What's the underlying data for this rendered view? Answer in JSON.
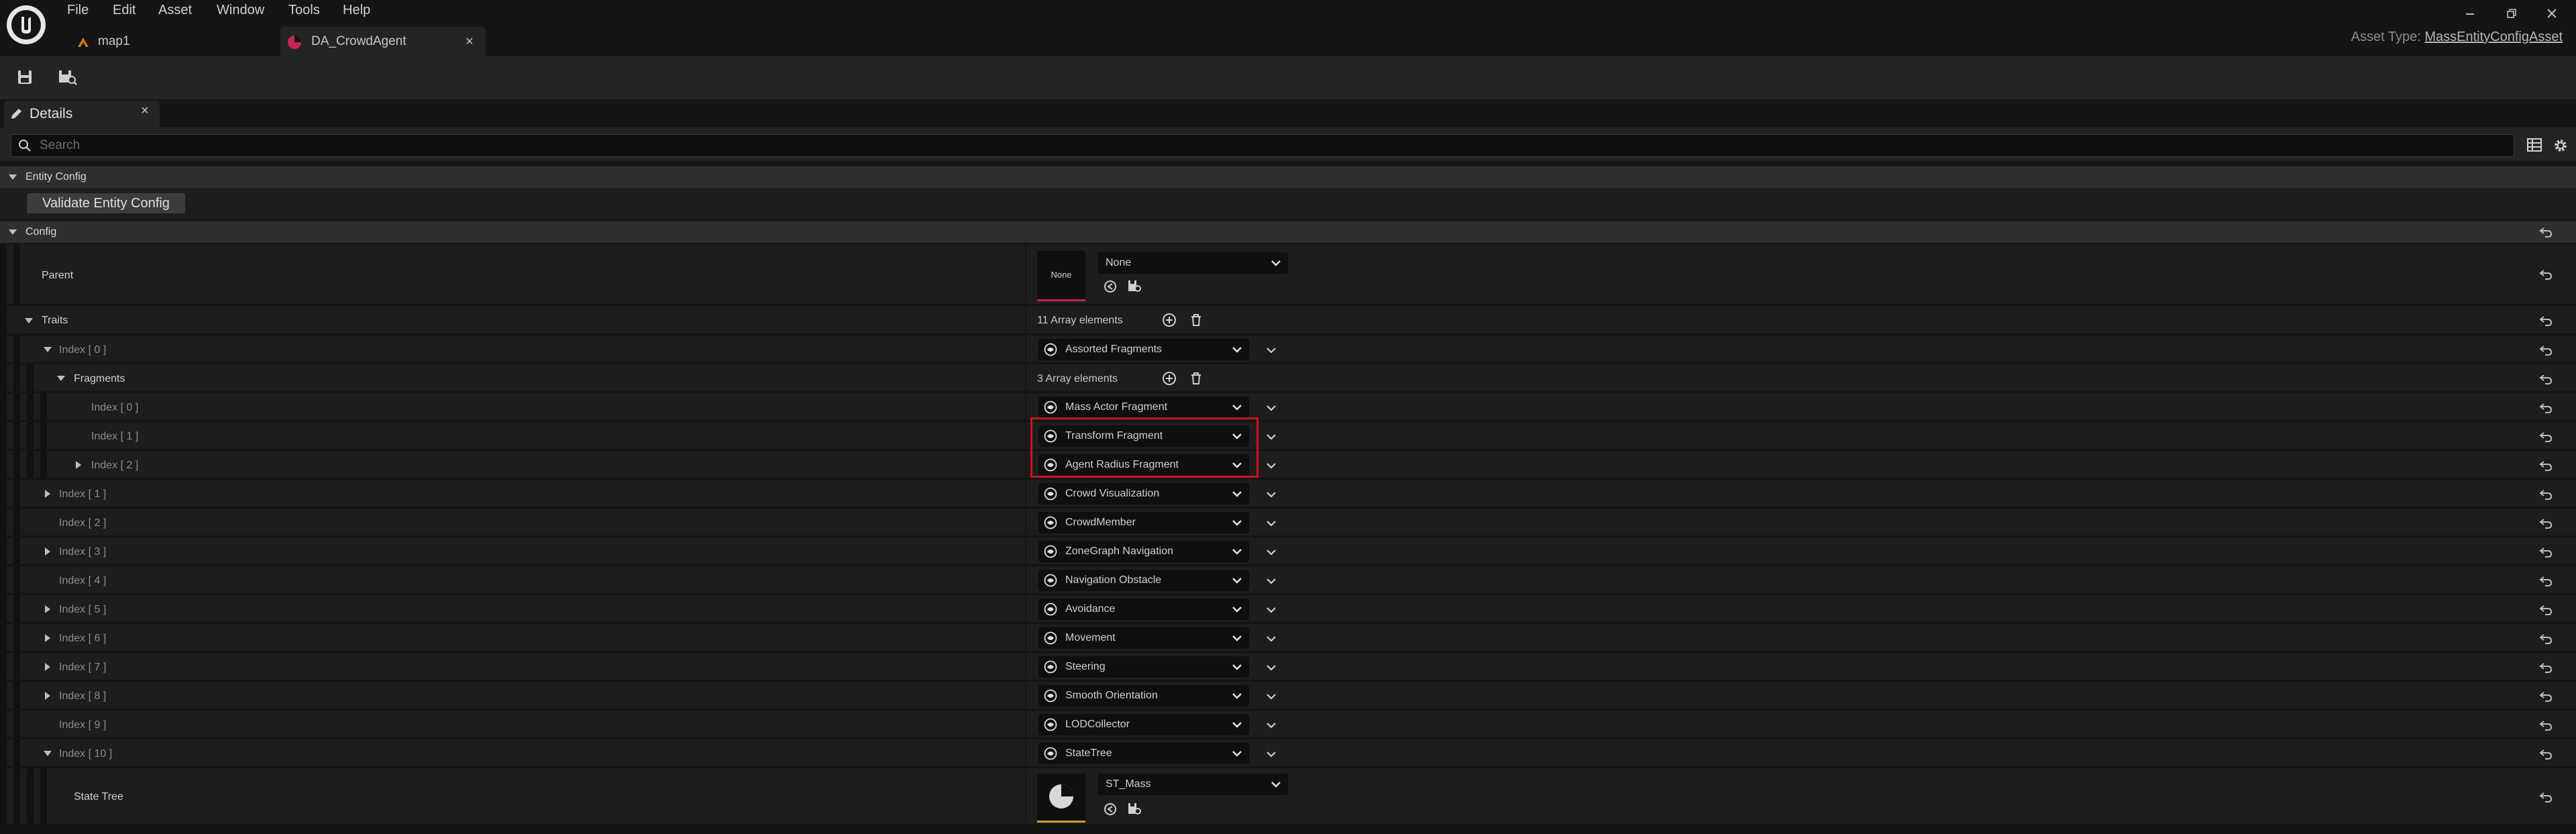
{
  "menu": [
    "File",
    "Edit",
    "Asset",
    "Window",
    "Tools",
    "Help"
  ],
  "tabs": {
    "map": "map1",
    "asset": "DA_CrowdAgent"
  },
  "asset_type": {
    "label": "Asset Type:",
    "value": "MassEntityConfigAsset"
  },
  "details": {
    "tab_label": "Details",
    "search_placeholder": "Search"
  },
  "entity_config": {
    "header": "Entity Config",
    "validate_button": "Validate Entity Config"
  },
  "config": {
    "header": "Config",
    "parent": {
      "label": "Parent",
      "thumb": "None",
      "value": "None"
    },
    "traits": {
      "label": "Traits",
      "count": "11 Array elements"
    },
    "fragments": {
      "label": "Fragments",
      "count": "3 Array elements"
    },
    "rows": [
      {
        "label": "Index [ 0 ]",
        "value": "Assorted Fragments"
      },
      {
        "label": "Index [ 0 ]",
        "value": "Mass Actor Fragment"
      },
      {
        "label": "Index [ 1 ]",
        "value": "Transform Fragment"
      },
      {
        "label": "Index [ 2 ]",
        "value": "Agent Radius Fragment"
      },
      {
        "label": "Index [ 1 ]",
        "value": "Crowd Visualization"
      },
      {
        "label": "Index [ 2 ]",
        "value": "CrowdMember"
      },
      {
        "label": "Index [ 3 ]",
        "value": "ZoneGraph Navigation"
      },
      {
        "label": "Index [ 4 ]",
        "value": "Navigation Obstacle"
      },
      {
        "label": "Index [ 5 ]",
        "value": "Avoidance"
      },
      {
        "label": "Index [ 6 ]",
        "value": "Movement"
      },
      {
        "label": "Index [ 7 ]",
        "value": "Steering"
      },
      {
        "label": "Index [ 8 ]",
        "value": "Smooth Orientation"
      },
      {
        "label": "Index [ 9 ]",
        "value": "LODCollector"
      },
      {
        "label": "Index [ 10 ]",
        "value": "StateTree"
      }
    ],
    "state_tree": {
      "label": "State Tree",
      "value": "ST_Mass"
    }
  },
  "highlight_color": "#c8141e",
  "icons": [
    "unreal-logo-icon",
    "map-icon",
    "data-asset-icon",
    "close-icon",
    "minimize-icon",
    "restore-icon",
    "save-icon",
    "browse-icon",
    "pencil-icon",
    "search-icon",
    "table-icon",
    "gear-icon",
    "reset-icon",
    "add-icon",
    "delete-icon",
    "chevron-down-icon",
    "class-icon"
  ]
}
